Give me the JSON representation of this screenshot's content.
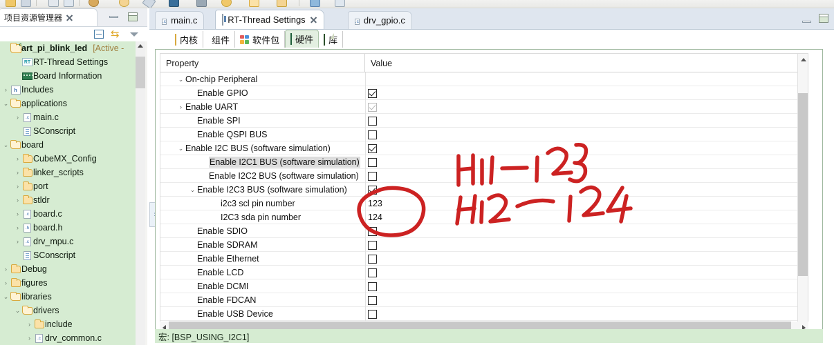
{
  "explorer": {
    "tab_label": "项目资源管理器",
    "close_icon": "close-icon",
    "toolbar": {
      "collapse_all": "collapse-all-icon",
      "link_with_editor": "link-editor-icon",
      "view_menu": "view-menu-icon"
    },
    "window": {
      "minimize": "minimize-icon",
      "maximize": "maximize-icon"
    },
    "tree": [
      {
        "label": "art_pi_blink_led",
        "suffix": "[Active -",
        "icon": "project-icon",
        "indent": 0,
        "twisty": "",
        "bold": true
      },
      {
        "label": "RT-Thread Settings",
        "suffix": "",
        "icon": "rt-thread-icon",
        "indent": 1,
        "twisty": "",
        "bold": false
      },
      {
        "label": "Board Information",
        "suffix": "",
        "icon": "board-icon",
        "indent": 1,
        "twisty": "",
        "bold": false
      },
      {
        "label": "Includes",
        "suffix": "",
        "icon": "includes-icon",
        "indent": 0,
        "twisty": "collapsed",
        "bold": false
      },
      {
        "label": "applications",
        "suffix": "",
        "icon": "folder-open-icon",
        "indent": 0,
        "twisty": "expanded",
        "bold": false
      },
      {
        "label": "main.c",
        "suffix": "",
        "icon": "c-file-icon",
        "indent": 1,
        "twisty": "collapsed",
        "bold": false
      },
      {
        "label": "SConscript",
        "suffix": "",
        "icon": "doc-icon",
        "indent": 1,
        "twisty": "",
        "bold": false
      },
      {
        "label": "board",
        "suffix": "",
        "icon": "folder-open-icon",
        "indent": 0,
        "twisty": "expanded",
        "bold": false
      },
      {
        "label": "CubeMX_Config",
        "suffix": "",
        "icon": "folder-icon",
        "indent": 1,
        "twisty": "collapsed",
        "bold": false
      },
      {
        "label": "linker_scripts",
        "suffix": "",
        "icon": "folder-icon",
        "indent": 1,
        "twisty": "collapsed",
        "bold": false
      },
      {
        "label": "port",
        "suffix": "",
        "icon": "folder-icon",
        "indent": 1,
        "twisty": "collapsed",
        "bold": false
      },
      {
        "label": "stldr",
        "suffix": "",
        "icon": "folder-icon",
        "indent": 1,
        "twisty": "collapsed",
        "bold": false
      },
      {
        "label": "board.c",
        "suffix": "",
        "icon": "c-file-icon",
        "indent": 1,
        "twisty": "collapsed",
        "bold": false
      },
      {
        "label": "board.h",
        "suffix": "",
        "icon": "h-file-icon",
        "indent": 1,
        "twisty": "collapsed",
        "bold": false
      },
      {
        "label": "drv_mpu.c",
        "suffix": "",
        "icon": "c-file-icon",
        "indent": 1,
        "twisty": "collapsed",
        "bold": false
      },
      {
        "label": "SConscript",
        "suffix": "",
        "icon": "doc-icon",
        "indent": 1,
        "twisty": "",
        "bold": false
      },
      {
        "label": "Debug",
        "suffix": "",
        "icon": "folder-icon",
        "indent": 0,
        "twisty": "collapsed",
        "bold": false
      },
      {
        "label": "figures",
        "suffix": "",
        "icon": "folder-icon",
        "indent": 0,
        "twisty": "collapsed",
        "bold": false
      },
      {
        "label": "libraries",
        "suffix": "",
        "icon": "folder-open-icon",
        "indent": 0,
        "twisty": "expanded",
        "bold": false
      },
      {
        "label": "drivers",
        "suffix": "",
        "icon": "folder-open-icon",
        "indent": 1,
        "twisty": "expanded",
        "bold": false
      },
      {
        "label": "include",
        "suffix": "",
        "icon": "folder-icon",
        "indent": 2,
        "twisty": "collapsed",
        "bold": false
      },
      {
        "label": "drv_common.c",
        "suffix": "",
        "icon": "c-file-icon",
        "indent": 2,
        "twisty": "collapsed",
        "bold": false
      }
    ]
  },
  "editor": {
    "tabs": [
      {
        "label": "main.c",
        "icon": "c-file-icon",
        "active": false,
        "closable": false
      },
      {
        "label": "RT-Thread Settings",
        "icon": "rt-settings-icon",
        "active": true,
        "closable": true
      },
      {
        "label": "drv_gpio.c",
        "icon": "c-file-icon",
        "active": false,
        "closable": false
      }
    ],
    "window": {
      "minimize": "minimize-icon",
      "maximize": "maximize-icon"
    },
    "restore_panel": "restore-panel-icon",
    "subtabs": [
      {
        "label": "内核",
        "icon": "kernel-icon",
        "active": false
      },
      {
        "label": "组件",
        "icon": "components-icon",
        "active": false
      },
      {
        "label": "软件包",
        "icon": "packages-icon",
        "active": false
      },
      {
        "label": "硬件",
        "icon": "hardware-icon",
        "active": true
      },
      {
        "label": "库",
        "icon": "library-icon",
        "active": false
      }
    ],
    "table": {
      "columns": [
        "Property",
        "Value"
      ],
      "rows": [
        {
          "label": "On-chip Peripheral",
          "indent": 1,
          "twisty": "expanded",
          "value_type": "none",
          "value": "",
          "highlight": false
        },
        {
          "label": "Enable GPIO",
          "indent": 2,
          "twisty": "",
          "value_type": "checkbox",
          "value": "checked",
          "highlight": false
        },
        {
          "label": "Enable UART",
          "indent": 1,
          "twisty": "collapsed",
          "value_type": "checkbox",
          "value": "checked-disabled",
          "highlight": false
        },
        {
          "label": "Enable SPI",
          "indent": 2,
          "twisty": "",
          "value_type": "checkbox",
          "value": "unchecked",
          "highlight": false
        },
        {
          "label": "Enable QSPI BUS",
          "indent": 2,
          "twisty": "",
          "value_type": "checkbox",
          "value": "unchecked",
          "highlight": false
        },
        {
          "label": "Enable I2C BUS (software simulation)",
          "indent": 1,
          "twisty": "expanded",
          "value_type": "checkbox",
          "value": "checked",
          "highlight": false
        },
        {
          "label": "Enable I2C1 BUS (software simulation)",
          "indent": 3,
          "twisty": "",
          "value_type": "checkbox",
          "value": "unchecked",
          "highlight": true
        },
        {
          "label": "Enable I2C2 BUS (software simulation)",
          "indent": 3,
          "twisty": "",
          "value_type": "checkbox",
          "value": "unchecked",
          "highlight": false
        },
        {
          "label": "Enable I2C3 BUS (software simulation)",
          "indent": 2,
          "twisty": "expanded",
          "value_type": "checkbox",
          "value": "checked",
          "highlight": false
        },
        {
          "label": "i2c3 scl pin number",
          "indent": 4,
          "twisty": "",
          "value_type": "text",
          "value": "123",
          "highlight": false
        },
        {
          "label": "I2C3 sda pin number",
          "indent": 4,
          "twisty": "",
          "value_type": "text",
          "value": "124",
          "highlight": false
        },
        {
          "label": "Enable SDIO",
          "indent": 2,
          "twisty": "",
          "value_type": "checkbox",
          "value": "unchecked",
          "highlight": false
        },
        {
          "label": "Enable SDRAM",
          "indent": 2,
          "twisty": "",
          "value_type": "checkbox",
          "value": "unchecked",
          "highlight": false
        },
        {
          "label": "Enable Ethernet",
          "indent": 2,
          "twisty": "",
          "value_type": "checkbox",
          "value": "unchecked",
          "highlight": false
        },
        {
          "label": "Enable LCD",
          "indent": 2,
          "twisty": "",
          "value_type": "checkbox",
          "value": "unchecked",
          "highlight": false
        },
        {
          "label": "Enable DCMI",
          "indent": 2,
          "twisty": "",
          "value_type": "checkbox",
          "value": "unchecked",
          "highlight": false
        },
        {
          "label": "Enable FDCAN",
          "indent": 2,
          "twisty": "",
          "value_type": "checkbox",
          "value": "unchecked",
          "highlight": false
        },
        {
          "label": "Enable USB Device",
          "indent": 2,
          "twisty": "",
          "value_type": "checkbox",
          "value": "unchecked",
          "highlight": false
        }
      ]
    },
    "macro_status": "宏: [BSP_USING_I2C1]"
  },
  "annotations": {
    "ink_color": "#cc2222",
    "notes": [
      {
        "text": "H11 — 123"
      },
      {
        "text": "H12 — 124"
      }
    ],
    "circle": "red-circle-around-pin-values"
  },
  "colors": {
    "tree_background": "#d6ecd2",
    "macro_background": "#d6ecd2",
    "editor_chrome": "#dfe6ef",
    "active_subtab": "#e3efe1",
    "ink": "#cc2222"
  }
}
